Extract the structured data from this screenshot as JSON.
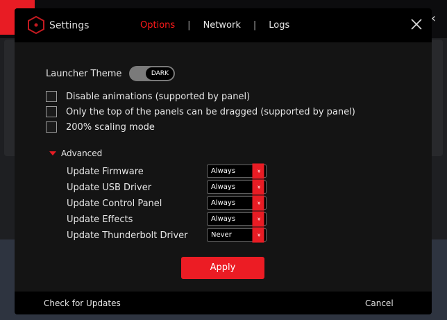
{
  "header": {
    "title": "Settings",
    "tabs": [
      {
        "label": "Options",
        "active": true
      },
      {
        "label": "Network"
      },
      {
        "label": "Logs"
      }
    ],
    "separator": "|"
  },
  "options": {
    "launcher_theme_label": "Launcher Theme",
    "theme_value": "DARK",
    "checkboxes": [
      {
        "label": "Disable animations (supported by panel)",
        "checked": false
      },
      {
        "label": "Only the top of the panels can be dragged (supported by panel)",
        "checked": false
      },
      {
        "label": "200% scaling mode",
        "checked": false
      }
    ],
    "advanced_label": "Advanced",
    "updates": [
      {
        "label": "Update Firmware",
        "value": "Always"
      },
      {
        "label": "Update USB Driver",
        "value": "Always"
      },
      {
        "label": "Update Control Panel",
        "value": "Always"
      },
      {
        "label": "Update Effects",
        "value": "Always"
      },
      {
        "label": "Update Thunderbolt Driver",
        "value": "Never"
      }
    ],
    "apply_label": "Apply"
  },
  "footer": {
    "check_updates": "Check for Updates",
    "cancel": "Cancel"
  },
  "colors": {
    "accent": "#ec1c24",
    "active_tab": "#ff1a1a"
  },
  "icons": {
    "logo": "hexagon-icon",
    "close": "close-icon",
    "dropdown": "double-chevron-down-icon"
  }
}
